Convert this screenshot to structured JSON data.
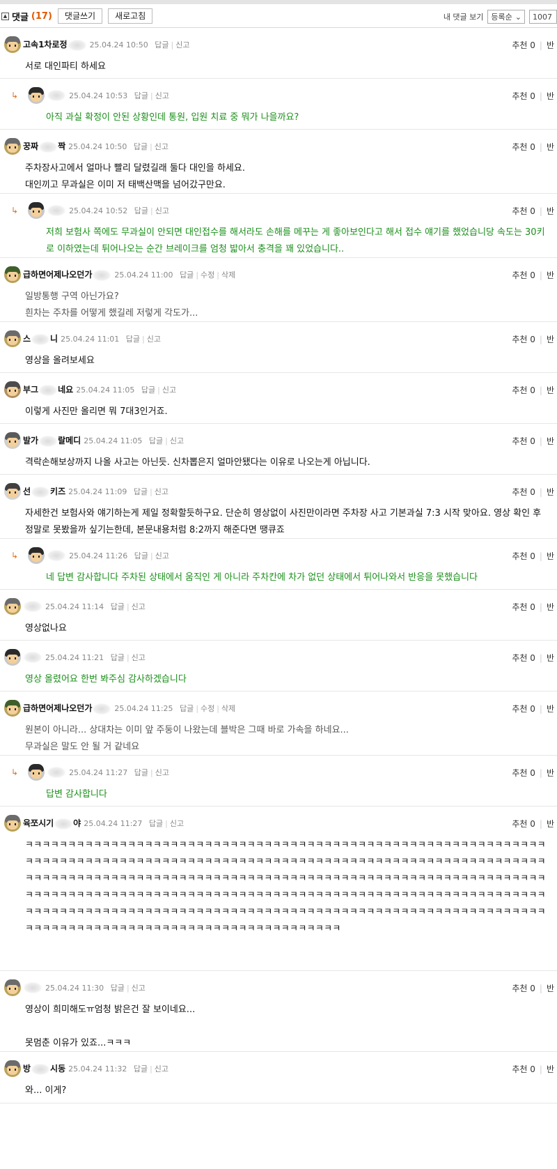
{
  "header": {
    "title": "댓글",
    "count": "(17)",
    "write_button": "댓글쓰기",
    "refresh_button": "새로고침",
    "my_comments": "내 댓글 보기",
    "sort_selected": "등록순",
    "page_value": "1007"
  },
  "comments": [
    {
      "nick_a": "고속1차로정",
      "nick_b": "",
      "time": "25.04.24 10:50",
      "actions": [
        "답글",
        "신고"
      ],
      "reco": "추천 0",
      "reco_extra": "반",
      "lines": [
        "서로 대인파티 하세요"
      ]
    },
    {
      "nick_a": "",
      "nick_b": "",
      "time": "25.04.24 10:53",
      "actions": [
        "답글",
        "신고"
      ],
      "reco": "추천 0",
      "reco_extra": "반",
      "lines": [
        "아직 과실 확정이 안된 상황인데 통원, 입원 치료 중 뭐가 나을까요?"
      ]
    },
    {
      "nick_a": "꿍짜",
      "nick_b": "짝",
      "time": "25.04.24 10:50",
      "actions": [
        "답글",
        "신고"
      ],
      "reco": "추천 0",
      "reco_extra": "반",
      "lines": [
        "주차장사고에서 얼마나 빨리 달렸길래 둘다 대인을 하세요.",
        "대인끼고 무과실은 이미 저 태백산맥을 넘어갔구만요."
      ]
    },
    {
      "nick_a": "",
      "nick_b": "",
      "time": "25.04.24 10:52",
      "actions": [
        "답글",
        "신고"
      ],
      "reco": "추천 0",
      "reco_extra": "반",
      "lines": [
        "저희 보험사 쪽에도 무과실이 안되면 대인접수를 해서라도 손해를 메꾸는 게 좋아보인다고 해서 접수 얘기를 했었습니당 속도는 30키로 이하였는데 튀어나오는 순간 브레이크를 엄청 밟아서 충격을 꽤 있었습니다.."
      ]
    },
    {
      "nick_a": "급하면어제나오던가",
      "nick_b": "",
      "time": "25.04.24 11:00",
      "actions": [
        "답글",
        "수정",
        "삭제"
      ],
      "reco": "추천 0",
      "reco_extra": "반",
      "lines": [
        "일방통행 구역 아닌가요?",
        "흰차는 주차를 어떻게 했길레 저렇게 각도가..."
      ]
    },
    {
      "nick_a": "스",
      "nick_b": "니",
      "time": "25.04.24 11:01",
      "actions": [
        "답글",
        "신고"
      ],
      "reco": "추천 0",
      "reco_extra": "반",
      "lines": [
        "영상을 올려보세요"
      ]
    },
    {
      "nick_a": "부그",
      "nick_b": "네요",
      "time": "25.04.24 11:05",
      "actions": [
        "답글",
        "신고"
      ],
      "reco": "추천 0",
      "reco_extra": "반",
      "lines": [
        "이렇게 사진만 올리면 뭐 7대3인거죠."
      ]
    },
    {
      "nick_a": "발가",
      "nick_b": "랄메디",
      "time": "25.04.24 11:05",
      "actions": [
        "답글",
        "신고"
      ],
      "reco": "추천 0",
      "reco_extra": "반",
      "lines": [
        "격락손해보상까지 나올 사고는 아닌듯. 신차뽑은지 얼마안됐다는 이유로 나오는게 아닙니다."
      ]
    },
    {
      "nick_a": "선",
      "nick_b": "키즈",
      "time": "25.04.24 11:09",
      "actions": [
        "답글",
        "신고"
      ],
      "reco": "추천 0",
      "reco_extra": "반",
      "lines": [
        "자세한건 보험사와 얘기하는게 제일 정확할듯하구요. 단순히 영상없이 사진만이라면 주차장 사고 기본과실 7:3 시작 맞아요. 영상 확인 후 정말로 못봤을까 싶기는한데, 본문내용처럼 8:2까지 해준다면 땡큐죠"
      ]
    },
    {
      "nick_a": "",
      "nick_b": "",
      "time": "25.04.24 11:26",
      "actions": [
        "답글",
        "신고"
      ],
      "reco": "추천 0",
      "reco_extra": "반",
      "lines": [
        "네 답변 감사합니다 주차된 상태에서 움직인 게 아니라 주차칸에 차가 없던 상태에서 튀어나와서 반응을 못했습니다"
      ]
    },
    {
      "nick_a": "",
      "nick_b": "",
      "time": "25.04.24 11:14",
      "actions": [
        "답글",
        "신고"
      ],
      "reco": "추천 0",
      "reco_extra": "반",
      "lines": [
        "영상없나요"
      ]
    },
    {
      "nick_a": "",
      "nick_b": "",
      "time": "25.04.24 11:21",
      "actions": [
        "답글",
        "신고"
      ],
      "reco": "추천 0",
      "reco_extra": "반",
      "lines": [
        "영상 올렸어요 한번 봐주심 감사하겠습니다"
      ]
    },
    {
      "nick_a": "급하면어제나오던가",
      "nick_b": "",
      "time": "25.04.24 11:25",
      "actions": [
        "답글",
        "수정",
        "삭제"
      ],
      "reco": "추천 0",
      "reco_extra": "반",
      "lines": [
        "원본이 아니라... 상대차는 이미 앞 주둥이 나왔는데 블박은 그때 바로 가속을 하네요...",
        "무과실은 말도 안 될 거 같네요"
      ]
    },
    {
      "nick_a": "",
      "nick_b": "",
      "time": "25.04.24 11:27",
      "actions": [
        "답글",
        "신고"
      ],
      "reco": "추천 0",
      "reco_extra": "반",
      "lines": [
        "답변 감사합니다"
      ]
    },
    {
      "nick_a": "육쪼시기",
      "nick_b": "야",
      "time": "25.04.24 11:27",
      "actions": [
        "답글",
        "신고"
      ],
      "reco": "추천 0",
      "reco_extra": "반",
      "lines": [
        "ㅋㅋㅋㅋㅋㅋㅋㅋㅋㅋㅋㅋㅋㅋㅋㅋㅋㅋㅋㅋㅋㅋㅋㅋㅋㅋㅋㅋㅋㅋㅋㅋㅋㅋㅋㅋㅋㅋㅋㅋㅋㅋㅋㅋㅋㅋㅋㅋㅋㅋㅋㅋㅋㅋㅋㅋㅋㅋㅋㅋㅋㅋㅋㅋㅋㅋㅋㅋㅋㅋㅋㅋㅋㅋㅋㅋㅋㅋㅋㅋㅋㅋㅋㅋㅋㅋㅋㅋㅋㅋㅋㅋㅋㅋㅋㅋㅋㅋㅋㅋㅋㅋㅋㅋㅋㅋㅋㅋㅋㅋㅋㅋㅋㅋㅋㅋㅋㅋㅋㅋㅋㅋㅋㅋㅋㅋㅋㅋㅋㅋㅋㅋㅋㅋㅋㅋㅋㅋㅋㅋㅋㅋㅋㅋㅋㅋㅋㅋㅋㅋㅋㅋㅋㅋㅋㅋㅋㅋㅋㅋㅋㅋㅋㅋㅋㅋㅋㅋㅋㅋㅋㅋㅋㅋㅋㅋㅋㅋㅋㅋㅋㅋㅋㅋㅋㅋㅋㅋㅋㅋㅋㅋㅋㅋㅋㅋㅋㅋㅋㅋㅋㅋㅋㅋㅋㅋㅋㅋㅋㅋㅋㅋㅋㅋㅋㅋㅋㅋㅋㅋㅋㅋㅋㅋㅋㅋㅋㅋㅋㅋㅋㅋㅋㅋㅋㅋㅋㅋㅋㅋㅋㅋㅋㅋㅋㅋㅋㅋㅋㅋㅋㅋㅋㅋㅋㅋㅋㅋㅋㅋㅋㅋㅋㅋㅋㅋㅋㅋㅋㅋㅋㅋㅋㅋㅋㅋㅋㅋㅋㅋㅋㅋㅋㅋㅋㅋㅋㅋㅋㅋㅋㅋㅋㅋㅋㅋㅋㅋㅋㅋㅋㅋㅋㅋㅋㅋㅋㅋㅋㅋㅋㅋㅋㅋㅋㅋㅋㅋㅋㅋㅋㅋㅋㅋㅋㅋㅋㅋㅋㅋㅋㅋㅋㅋㅋㅋㅋㅋㅋㅋㅋㅋ"
      ]
    },
    {
      "nick_a": "",
      "nick_b": "",
      "time": "25.04.24 11:30",
      "actions": [
        "답글",
        "신고"
      ],
      "reco": "추천 0",
      "reco_extra": "반",
      "lines": [
        "영상이 희미해도ㅠ엄청 밝은건 잘 보이네요...",
        "",
        "못멈춘 이유가 있죠...ㅋㅋㅋ"
      ]
    },
    {
      "nick_a": "방",
      "nick_b": "시동",
      "time": "25.04.24 11:32",
      "actions": [
        "답글",
        "신고"
      ],
      "reco": "추천 0",
      "reco_extra": "반",
      "lines": [
        "와... 이게?"
      ]
    }
  ]
}
